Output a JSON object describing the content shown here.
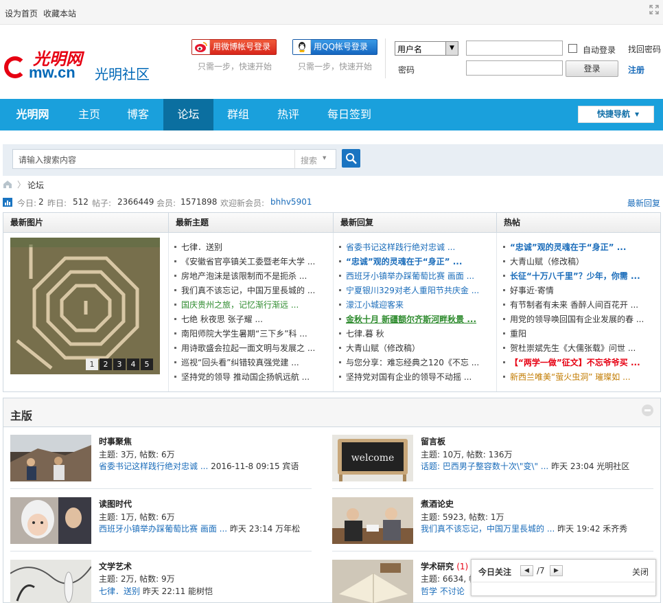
{
  "topbar": {
    "set_home": "设为首页",
    "bookmark": "收藏本站"
  },
  "header": {
    "logo_main": "mw.cn",
    "logo_red": "光明网",
    "logo_sub": "光明社区",
    "weibo_login": "用微博帐号登录",
    "qq_login": "用QQ帐号登录",
    "hint": "只需一步，快速开始",
    "account_select": "用户名",
    "password_label": "密码",
    "auto_login": "自动登录",
    "find_password": "找回密码",
    "login_button": "登录",
    "register": "注册"
  },
  "nav": {
    "brand": "光明网",
    "items": [
      "主页",
      "博客",
      "论坛",
      "群组",
      "热评",
      "每日签到"
    ],
    "active": "论坛",
    "quick_nav": "快捷导航"
  },
  "search": {
    "placeholder": "请输入搜索内容",
    "type": "搜索"
  },
  "breadcrumb": {
    "current": "论坛"
  },
  "stats": {
    "today_label": "今日:",
    "today": "2",
    "yesterday_label": "昨日:",
    "yesterday": "512",
    "posts_label": "帖子:",
    "posts": "2366449",
    "members_label": "会员:",
    "members": "1571898",
    "welcome_label": "欢迎新会员:",
    "new_member": "bhhv5901",
    "latest_reply": "最新回复"
  },
  "portal": {
    "headers": [
      "最新图片",
      "最新主题",
      "最新回复",
      "热帖"
    ],
    "pager": [
      "1",
      "2",
      "3",
      "4",
      "5"
    ],
    "latest_topics": [
      "七律．送别",
      "《安徽省官亭镇关工委暨老年大学 ...",
      "房地产泡沫是该限制而不是扼杀 ...",
      "我们真不该忘记，中国万里長城的 ...",
      "国庆贵州之旅，记忆渐行渐远 ...",
      "七绝 秋夜思 张子耀 ...",
      "南阳师院大学生暑期“三下乡”科 ...",
      "用诗歌盛会拉起一面文明与发展之 ...",
      "巡视“回头看”纠错较真强党建 ...",
      "坚持党的领导 推动国企扬帆远航 ..."
    ],
    "latest_replies": [
      "省委书记这样践行绝对忠诚 ...",
      "“忠诚”观的灵魂在于“身正” ...",
      "西班牙小镇举办踩葡萄比赛 画面 ...",
      "宁夏银川329对老人重阳节共庆金 ...",
      "濛江小城迎客来",
      "金秋十月 新疆额尔齐斯河畔秋景 ...",
      "七律.暮 秋",
      "大青山赋（修改稿）",
      "与您分享：难忘经典之120《不忘 ...",
      "坚持党对国有企业的领导不动摇 ..."
    ],
    "hot_posts": [
      "“忠诚”观的灵魂在于“身正” ...",
      "大青山赋（修改稿）",
      "长征“十万八千里”？少年，你需 ...",
      "好事近·寄情",
      "有节制者有未来 香醉人间百花开 ...",
      "用党的领导唤回国有企业发展的春 ...",
      "重阳",
      "贺杜崇斌先生《大儒张载》问世 ...",
      "【“两学一做”征文】不忘爷爷买 ...",
      "新西兰唯美“萤火虫洞” 璀璨如 ..."
    ]
  },
  "main": {
    "title": "主版",
    "forums": [
      {
        "name": "时事聚焦",
        "meta": "主题: 3万, 帖数: 6万",
        "last_title": "省委书记这样践行绝对忠诚 ...",
        "last_info": " 2016-11-8 09:15 宾语",
        "count": ""
      },
      {
        "name": "留言板",
        "meta": "主题: 10万, 帖数: 136万",
        "last_title": "话题: 巴西男子整容数十次\\\"变\\\" ...",
        "last_info": " 昨天 23:04 光明社区",
        "count": ""
      },
      {
        "name": "读图时代",
        "meta": "主题: 1万, 帖数: 6万",
        "last_title": "西班牙小镇举办踩葡萄比赛 画面 ...",
        "last_info": " 昨天 23:14 万年松",
        "count": ""
      },
      {
        "name": "煮酒论史",
        "meta": "主题: 5923, 帖数: 1万",
        "last_title": "我们真不该忘记，中国万里長城的 ...",
        "last_info": " 昨天 19:42 禾齐秀",
        "count": ""
      },
      {
        "name": "文学艺术",
        "meta": "主题: 2万, 帖数: 9万",
        "last_title": "七律．送别",
        "last_info": " 昨天 22:11 能树恺",
        "count": ""
      },
      {
        "name": "学术研究",
        "meta": "主题: 6634, 帖",
        "last_title": "哲学 不讨论",
        "last_info": "",
        "count": "(1)"
      }
    ],
    "welcome_sign": "welcome"
  },
  "attention": {
    "title": "今日关注",
    "page": "/7",
    "close": "关闭"
  },
  "colors": {
    "nav": "#1aa0dc",
    "nav_active": "#0b6fa0",
    "link_blue": "#1a6cba",
    "green": "#2e8b2e",
    "red": "#e60012",
    "orange": "#c27b00"
  }
}
